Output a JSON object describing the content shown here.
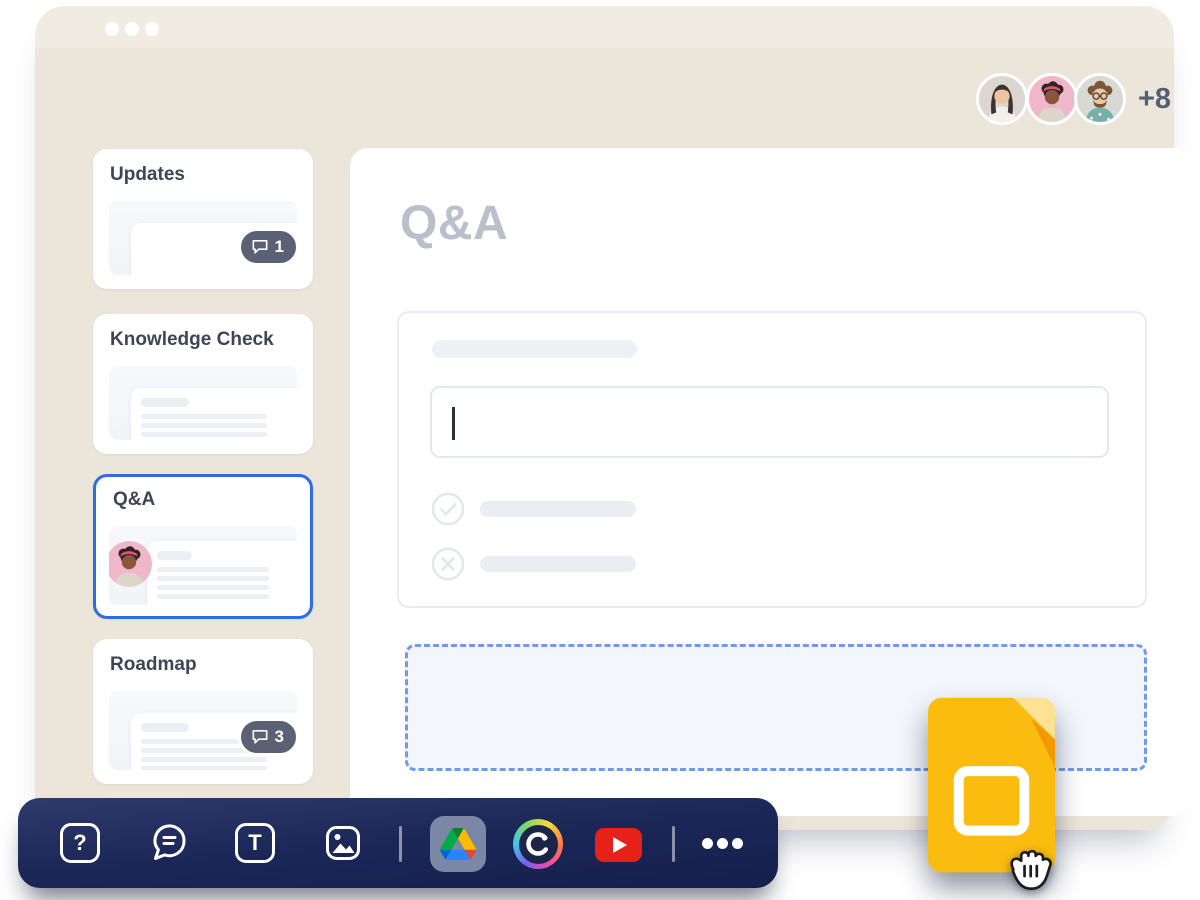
{
  "titlebar": {
    "window_controls": [
      "dot",
      "dot",
      "dot"
    ]
  },
  "collaborators": {
    "overflow_label": "+8",
    "avatars": [
      {
        "name": "collaborator-1"
      },
      {
        "name": "collaborator-2"
      },
      {
        "name": "collaborator-3"
      }
    ]
  },
  "sidebar": {
    "cards": [
      {
        "label": "Updates",
        "badge": "1",
        "selected": false
      },
      {
        "label": "Knowledge Check",
        "selected": false
      },
      {
        "label": "Q&A",
        "selected": true
      },
      {
        "label": "Roadmap",
        "badge": "3",
        "selected": false
      }
    ]
  },
  "main": {
    "title": "Q&A",
    "input_value": "",
    "dropzone": "empty-drop-target"
  },
  "toolbar": {
    "help_glyph": "?",
    "text_glyph": "T",
    "items": [
      "help",
      "comments",
      "text",
      "image",
      "google-drive",
      "gradient-ring-media",
      "youtube",
      "more-options"
    ]
  },
  "drag": {
    "item": "google-slides-file"
  },
  "colors": {
    "window_beige": "#ECE6DA",
    "selection_blue": "#2E6BE5",
    "toolbar_navy_top": "#2E3B6C",
    "toolbar_navy_bottom": "#141F4C",
    "badge_slate": "#5A6174",
    "youtube_red": "#E62117",
    "slides_yellow": "#FBBC10",
    "dropzone_blue": "#6F9BEB",
    "muted_title_gray": "#B9BFCB"
  }
}
